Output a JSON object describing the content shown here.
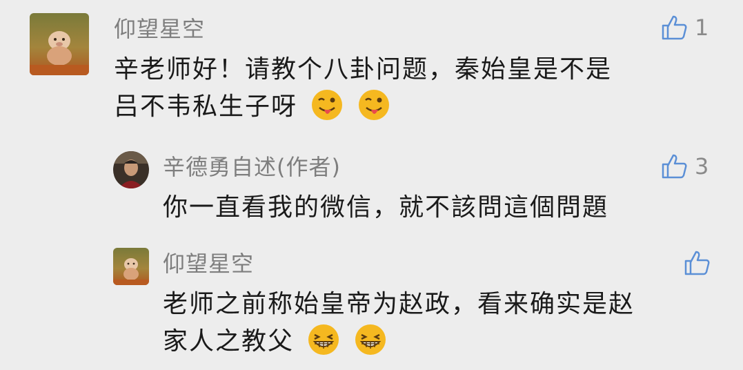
{
  "comments": [
    {
      "author": "仰望星空",
      "text": "辛老师好！请教个八卦问题，秦始皇是不是吕不韦私生子呀",
      "text_line1": "辛老师好！请教个八卦问题，秦始皇是不是",
      "text_line2": "吕不韦私生子呀",
      "likes": "1",
      "emoji": [
        "tongue-wink-emoji",
        "tongue-wink-emoji"
      ]
    },
    {
      "author": "辛德勇自述(作者)",
      "text": "你一直看我的微信，就不該問這個問題",
      "likes": "3",
      "emoji": []
    },
    {
      "author": "仰望星空",
      "text_line1": "老师之前称始皇帝为赵政，看来确实是赵",
      "text_line2": "家人之教父",
      "likes": "",
      "emoji": [
        "grin-emoji",
        "grin-emoji"
      ]
    }
  ],
  "colors": {
    "background": "#ededed",
    "name": "#7e7e7e",
    "text": "#1a1a1a",
    "like": "#8a8a8a",
    "emoji_yellow": "#f5b820"
  },
  "icons": {
    "like": "thumbs-up-outline-icon",
    "avatar_user": "pig-avatar",
    "avatar_author": "author-photo-avatar"
  }
}
